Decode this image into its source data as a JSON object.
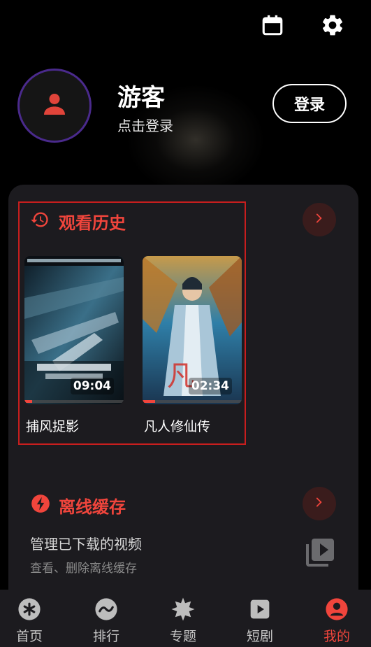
{
  "header": {
    "calendar_icon": "calendar-icon",
    "settings_icon": "gear-icon"
  },
  "profile": {
    "username": "游客",
    "subtitle": "点击登录",
    "login_label": "登录",
    "avatar_icon": "person-icon"
  },
  "history": {
    "title": "观看历史",
    "items": [
      {
        "title": "捕风捉影",
        "time": "09:04",
        "progress": 0.08
      },
      {
        "title": "凡人修仙传",
        "time": "02:34",
        "progress": 0.13
      }
    ]
  },
  "offline": {
    "title": "离线缓存",
    "description": "管理已下载的视频",
    "subtitle": "查看、删除离线缓存"
  },
  "tabs": [
    {
      "label": "首页",
      "icon": "asterisk-icon",
      "active": false
    },
    {
      "label": "排行",
      "icon": "trend-icon",
      "active": false
    },
    {
      "label": "专题",
      "icon": "starburst-icon",
      "active": false
    },
    {
      "label": "短剧",
      "icon": "play-icon",
      "active": false
    },
    {
      "label": "我的",
      "icon": "person-icon",
      "active": true
    }
  ],
  "colors": {
    "accent": "#f0453c",
    "card": "#1c1b1f",
    "avatar_ring": "#4a2a8c"
  }
}
